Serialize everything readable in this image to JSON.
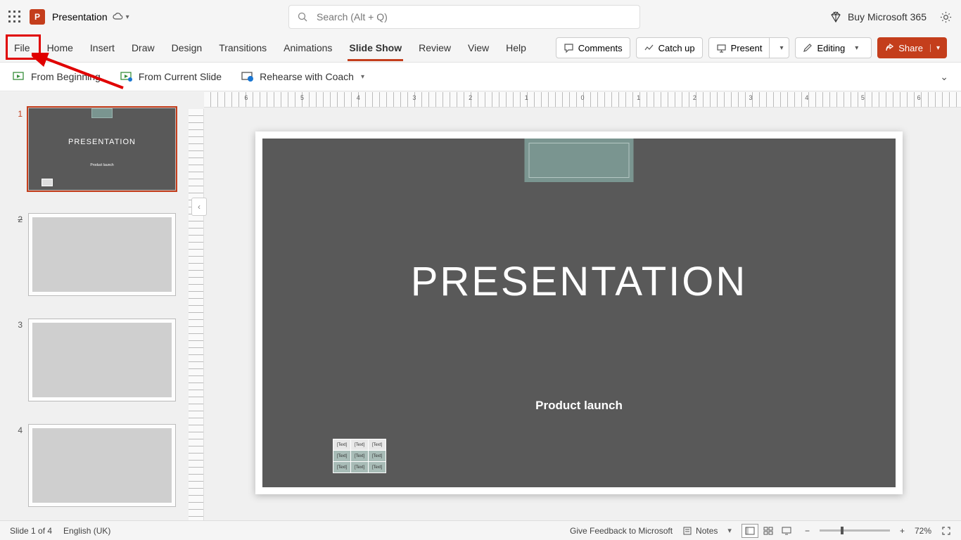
{
  "title": {
    "doc_name": "Presentation"
  },
  "search": {
    "placeholder": "Search (Alt + Q)"
  },
  "title_right": {
    "buy": "Buy Microsoft 365"
  },
  "tabs": {
    "file": "File",
    "home": "Home",
    "insert": "Insert",
    "draw": "Draw",
    "design": "Design",
    "transitions": "Transitions",
    "animations": "Animations",
    "slideshow": "Slide Show",
    "review": "Review",
    "view": "View",
    "help": "Help"
  },
  "ribbon_right": {
    "comments": "Comments",
    "catchup": "Catch up",
    "present": "Present",
    "editing": "Editing",
    "share": "Share"
  },
  "sub_ribbon": {
    "from_beginning": "From Beginning",
    "from_current": "From Current Slide",
    "rehearse": "Rehearse with Coach"
  },
  "thumbs": {
    "n1": "1",
    "n2": "2",
    "n3": "3",
    "n4": "4",
    "t1_title": "PRESENTATION",
    "t1_sub": "Product launch"
  },
  "slide": {
    "title": "PRESENTATION",
    "subtitle": "Product launch",
    "cell": "[Text]"
  },
  "ruler_labels": [
    "6",
    "5",
    "4",
    "3",
    "2",
    "1",
    "0",
    "1",
    "2",
    "3",
    "4",
    "5",
    "6"
  ],
  "status": {
    "slide_info": "Slide 1 of 4",
    "language": "English (UK)",
    "feedback": "Give Feedback to Microsoft",
    "notes": "Notes",
    "zoom": "72%"
  }
}
